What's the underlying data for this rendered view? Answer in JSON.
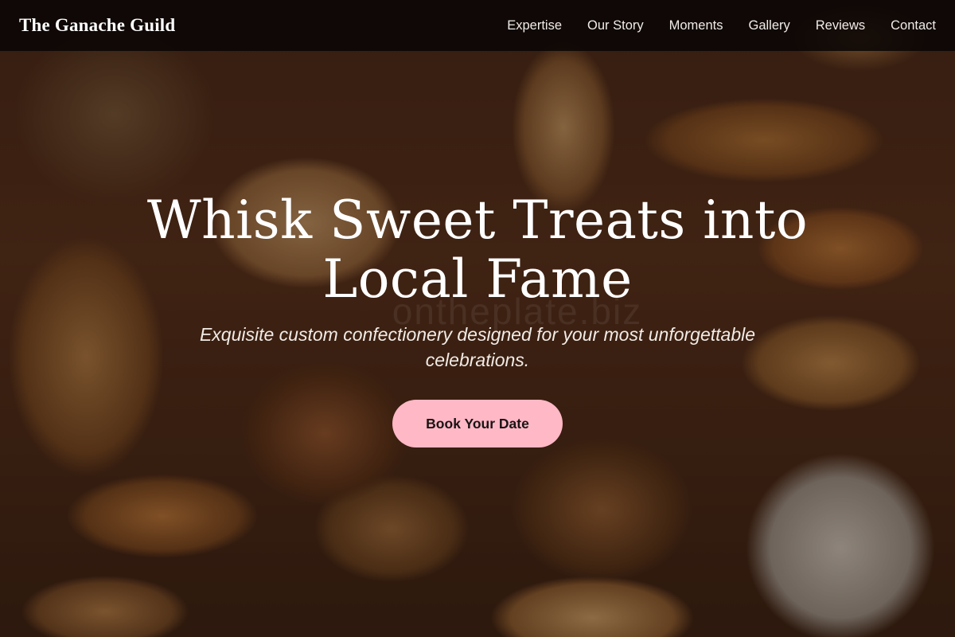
{
  "nav": {
    "brand": "The Ganache Guild",
    "links": [
      {
        "label": "Expertise"
      },
      {
        "label": "Our Story"
      },
      {
        "label": "Moments"
      },
      {
        "label": "Gallery"
      },
      {
        "label": "Reviews"
      },
      {
        "label": "Contact"
      }
    ]
  },
  "hero": {
    "headline_line1": "Whisk Sweet Treats into",
    "headline_line2": "Local Fame",
    "subheadline_line1": "Exquisite custom confectionery designed for your most unforgettable",
    "subheadline_line2": "celebrations.",
    "cta_label": "Book Your Date",
    "cta_color": "#ffb8c6",
    "watermark_text": "ontheplate.biz",
    "background_description": "bread"
  },
  "colors": {
    "navbar_bg": "#0a0604",
    "text_primary": "#ffffff"
  }
}
